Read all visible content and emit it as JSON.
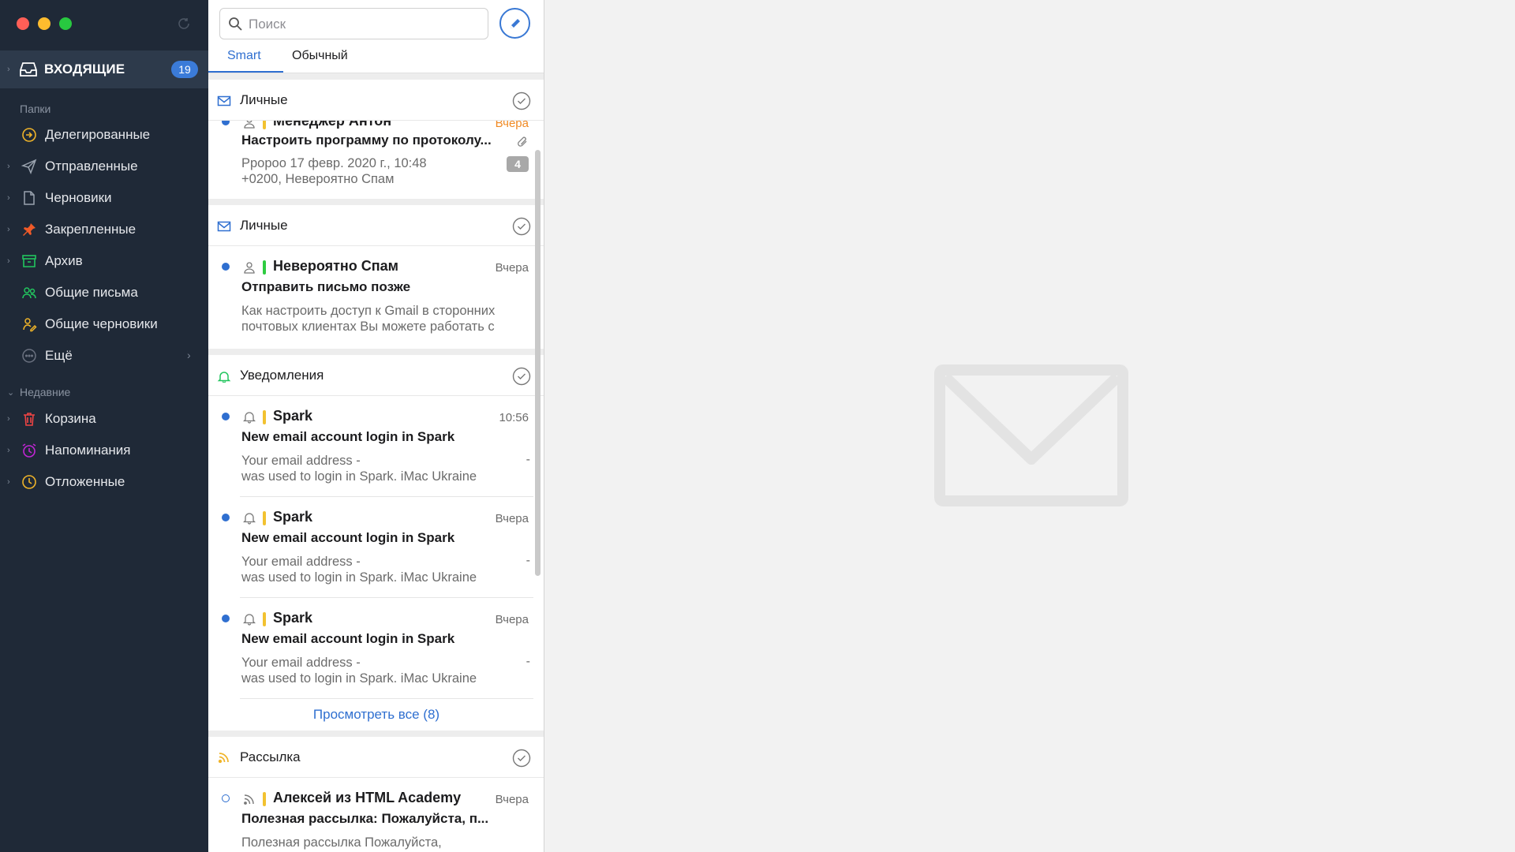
{
  "sidebar": {
    "inbox": {
      "label": "ВХОДЯЩИЕ",
      "badge": "19"
    },
    "folders_label": "Папки",
    "folders": [
      {
        "label": "Делегированные"
      },
      {
        "label": "Отправленные"
      },
      {
        "label": "Черновики"
      },
      {
        "label": "Закрепленные"
      },
      {
        "label": "Архив"
      },
      {
        "label": "Общие письма"
      },
      {
        "label": "Общие черновики"
      },
      {
        "label": "Ещё"
      }
    ],
    "recent_label": "Недавние",
    "recent": [
      {
        "label": "Корзина"
      },
      {
        "label": "Напоминания"
      },
      {
        "label": "Отложенные"
      }
    ]
  },
  "list": {
    "search": {
      "placeholder": "Поиск"
    },
    "tabs": [
      {
        "label": "Smart"
      },
      {
        "label": "Обычный"
      }
    ],
    "groups": [
      {
        "title": "Личные",
        "messages": [
          {
            "sender": "Менеджер Антон",
            "time": "Вчера",
            "subject": "Настроить программу по протоколу...",
            "preview": [
              "Рророо 17 февр. 2020 г., 10:48",
              "+0200, Невероятно Спам"
            ],
            "count": "4"
          }
        ]
      },
      {
        "title": "Личные",
        "messages": [
          {
            "sender": "Невероятно Спам",
            "time": "Вчера",
            "subject": "Отправить письмо позже",
            "preview": [
              "Как настроить доступ к Gmail в сторонних",
              "почтовых клиентах Вы можете работать с"
            ]
          }
        ]
      },
      {
        "title": "Уведомления",
        "messages": [
          {
            "sender": "Spark",
            "time": "10:56",
            "subject": "New email account login in Spark",
            "preview": [
              "Your email address -",
              "was used to login in Spark. iMac Ukraine"
            ],
            "dash": "-"
          },
          {
            "sender": "Spark",
            "time": "Вчера",
            "subject": "New email account login in Spark",
            "preview": [
              "Your email address -",
              "was used to login in Spark. iMac Ukraine"
            ],
            "dash": "-"
          },
          {
            "sender": "Spark",
            "time": "Вчера",
            "subject": "New email account login in Spark",
            "preview": [
              "Your email address -",
              "was used to login in Spark. iMac Ukraine"
            ],
            "dash": "-"
          }
        ],
        "view_all": "Просмотреть все (8)"
      },
      {
        "title": "Рассылка",
        "messages": [
          {
            "sender": "Алексей из HTML Academy",
            "time": "Вчера",
            "subject": "Полезная рассылка: Пожалуйста, п...",
            "preview": [
              "Полезная рассылка Пожалуйста,"
            ]
          }
        ]
      }
    ]
  },
  "colors": {
    "accent": "#2f6fd0",
    "sidebar_bg": "#1f2937",
    "sender_bar_yellow": "#f2c230",
    "sender_bar_green": "#2ecc40"
  },
  "icons": {
    "sidebar": [
      "inbox-icon",
      "delegated-icon",
      "send-icon",
      "draft-icon",
      "pin-icon",
      "archive-icon",
      "shared-icon",
      "shared-drafts-icon",
      "more-icon",
      "trash-icon",
      "alarm-icon",
      "clock-icon"
    ],
    "groups": [
      "envelope-icon",
      "envelope-icon",
      "bell-icon",
      "rss-icon"
    ]
  }
}
